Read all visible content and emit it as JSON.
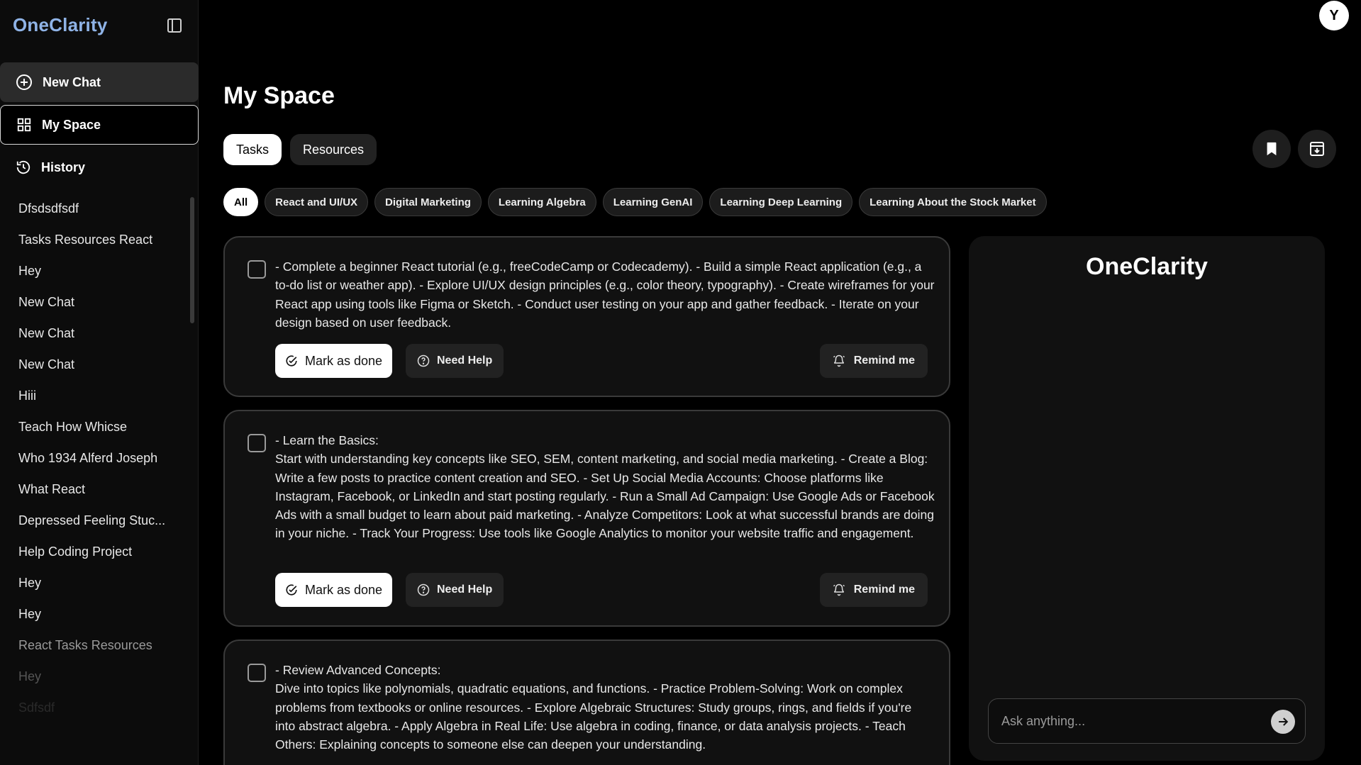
{
  "sidebar": {
    "brand": "OneClarity",
    "new_chat": "New Chat",
    "my_space": "My Space",
    "history": "History",
    "history_items": [
      "Dfsdsdfsdf",
      "Tasks Resources React",
      "Hey",
      "New Chat",
      "New Chat",
      "New Chat",
      "Hiii",
      "Teach How Whicse",
      "Who 1934 Alferd Joseph",
      "What React",
      "Depressed Feeling Stuc...",
      "Help Coding Project",
      "Hey",
      "Hey",
      "React Tasks Resources",
      "Hey",
      "Sdfsdf"
    ]
  },
  "user": {
    "avatar_initial": "Y"
  },
  "main": {
    "title": "My Space",
    "tabs": [
      {
        "label": "Tasks",
        "active": true
      },
      {
        "label": "Resources",
        "active": false
      }
    ],
    "filters": [
      "All",
      "React and UI/UX",
      "Digital Marketing",
      "Learning Algebra",
      "Learning GenAI",
      "Learning Deep Learning",
      "Learning About the Stock Market"
    ],
    "task_actions": {
      "done": "Mark as done",
      "help": "Need Help",
      "remind": "Remind me"
    },
    "tasks": [
      {
        "text": "- Complete a beginner React tutorial (e.g., freeCodeCamp or Codecademy). - Build a simple React application (e.g., a to-do list or weather app). - Explore UI/UX design principles (e.g., color theory, typography). - Create wireframes for your React app using tools like Figma or Sketch. - Conduct user testing on your app and gather feedback. - Iterate on your design based on user feedback."
      },
      {
        "text": "- Learn the Basics:\nStart with understanding key concepts like SEO, SEM, content marketing, and social media marketing. - Create a Blog: Write a few posts to practice content creation and SEO. - Set Up Social Media Accounts: Choose platforms like Instagram, Facebook, or LinkedIn and start posting regularly. - Run a Small Ad Campaign: Use Google Ads or Facebook Ads with a small budget to learn about paid marketing. - Analyze Competitors: Look at what successful brands are doing in your niche. - Track Your Progress: Use tools like Google Analytics to monitor your website traffic and engagement."
      },
      {
        "text": "- Review Advanced Concepts:\nDive into topics like polynomials, quadratic equations, and functions. - Practice Problem-Solving: Work on complex problems from textbooks or online resources. - Explore Algebraic Structures: Study groups, rings, and fields if you're into abstract algebra. - Apply Algebra in Real Life: Use algebra in coding, finance, or data analysis projects. - Teach Others: Explaining concepts to someone else can deepen your understanding."
      }
    ]
  },
  "chat": {
    "brand": "OneClarity",
    "placeholder": "Ask anything..."
  },
  "colors": {
    "brand": "#8fb3e6",
    "background": "#000000",
    "card": "#111111"
  }
}
